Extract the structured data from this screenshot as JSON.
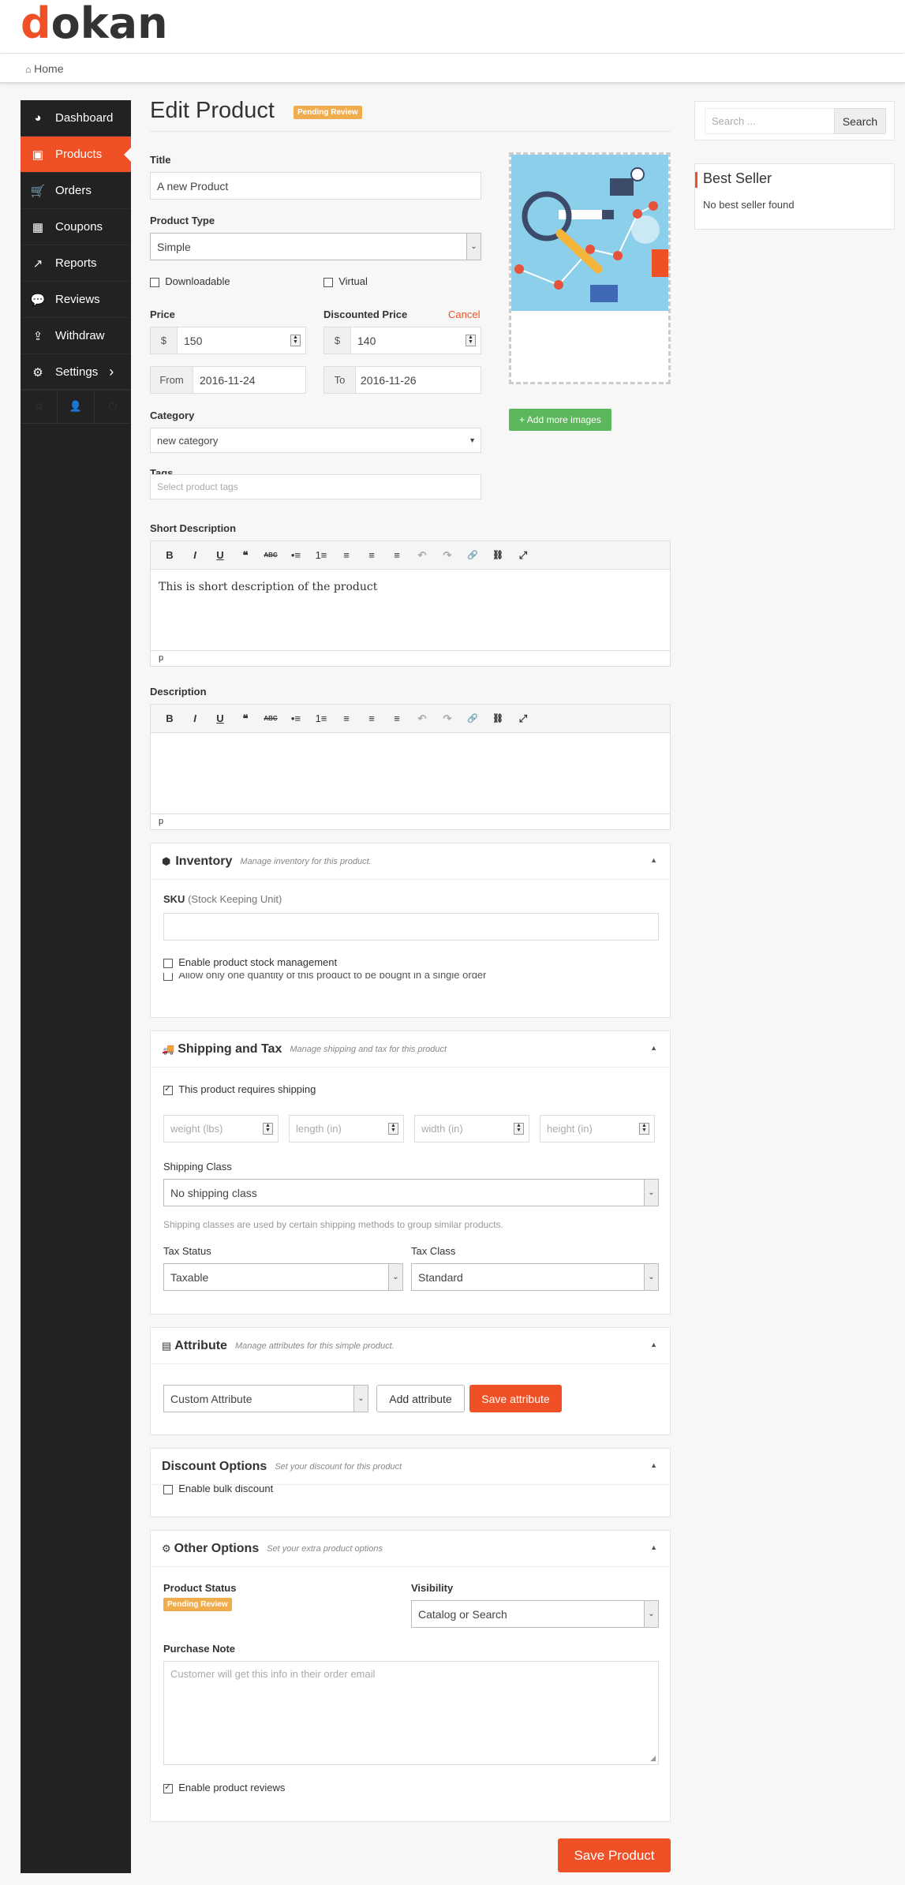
{
  "header": {
    "logo_first": "d",
    "logo_rest": "okan",
    "breadcrumb": "Home"
  },
  "sidebar": {
    "items": [
      {
        "label": "Dashboard",
        "icon": "dashboard-icon"
      },
      {
        "label": "Products",
        "icon": "briefcase-icon"
      },
      {
        "label": "Orders",
        "icon": "cart-icon"
      },
      {
        "label": "Coupons",
        "icon": "gift-icon"
      },
      {
        "label": "Reports",
        "icon": "chart-line-icon"
      },
      {
        "label": "Reviews",
        "icon": "comments-icon"
      },
      {
        "label": "Withdraw",
        "icon": "upload-icon"
      },
      {
        "label": "Settings",
        "icon": "gear-icon"
      }
    ],
    "settings_arrow": "›"
  },
  "page": {
    "title": "Edit Product",
    "status_badge": "Pending Review"
  },
  "form": {
    "title_label": "Title",
    "title_value": "A new Product",
    "type_label": "Product Type",
    "type_value": "Simple",
    "downloadable_label": "Downloadable",
    "virtual_label": "Virtual",
    "price_label": "Price",
    "price_value": "150",
    "currency": "$",
    "discount_label": "Discounted Price",
    "discount_cancel": "Cancel",
    "discount_value": "140",
    "from_label": "From",
    "from_value": "2016-11-24",
    "to_label": "To",
    "to_value": "2016-11-26",
    "category_label": "Category",
    "category_value": "new category",
    "tags_label": "Tags",
    "tags_placeholder": "Select product tags",
    "add_images": "+ Add more images",
    "short_desc_label": "Short Description",
    "short_desc_text": "This is short description of the product",
    "short_desc_path": "p",
    "desc_label": "Description",
    "desc_path": "p",
    "toolbar": [
      "B",
      "I",
      "U",
      "❝",
      "ABC",
      "•≡",
      "1≡",
      "≡",
      "≡",
      "≡",
      "↶",
      "↷",
      "🔗",
      "⛓",
      "⤢"
    ]
  },
  "inventory": {
    "title": "Inventory",
    "subtitle": "Manage inventory for this product.",
    "sku_label": "SKU",
    "sku_hint": "(Stock Keeping Unit)",
    "stock_label": "Enable product stock management",
    "single_label": "Allow only one quantity of this product to be bought in a single order"
  },
  "shipping": {
    "title": "Shipping and Tax",
    "subtitle": "Manage shipping and tax for this product",
    "requires_label": "This product requires shipping",
    "weight_ph": "weight (lbs)",
    "length_ph": "length (in)",
    "width_ph": "width (in)",
    "height_ph": "height (in)",
    "class_label": "Shipping Class",
    "class_value": "No shipping class",
    "class_hint": "Shipping classes are used by certain shipping methods to group similar products.",
    "tax_status_label": "Tax Status",
    "tax_status_value": "Taxable",
    "tax_class_label": "Tax Class",
    "tax_class_value": "Standard"
  },
  "attribute": {
    "title": "Attribute",
    "subtitle": "Manage attributes for this simple product.",
    "select_value": "Custom Attribute",
    "add_btn": "Add attribute",
    "save_btn": "Save attribute"
  },
  "discount": {
    "title": "Discount Options",
    "subtitle": "Set your discount for this product",
    "bulk_label": "Enable bulk discount"
  },
  "other": {
    "title": "Other Options",
    "subtitle": "Set your extra product options",
    "status_label": "Product Status",
    "status_badge": "Pending Review",
    "visibility_label": "Visibility",
    "visibility_value": "Catalog or Search",
    "note_label": "Purchase Note",
    "note_placeholder": "Customer will get this info in their order email",
    "reviews_label": "Enable product reviews"
  },
  "save_button": "Save Product",
  "widgets": {
    "search_placeholder": "Search ...",
    "search_button": "Search",
    "best_seller_title": "Best Seller",
    "best_seller_empty": "No best seller found"
  },
  "colors": {
    "accent": "#f05025",
    "sidebar": "#222222",
    "green": "#5cb85c",
    "badge": "#f0ad4e"
  }
}
